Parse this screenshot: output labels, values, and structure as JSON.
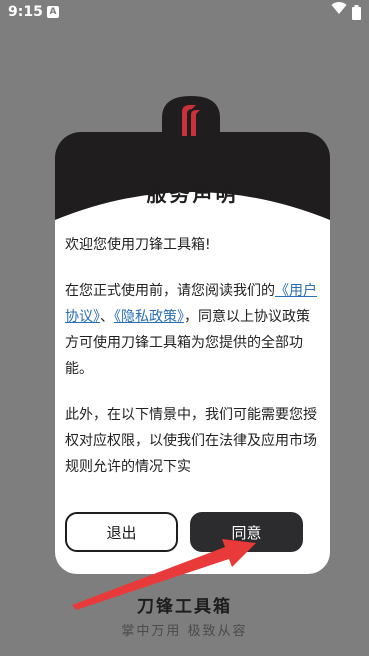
{
  "status_bar": {
    "time": "9:15",
    "notification_letter": "A",
    "icons": [
      "wifi-icon",
      "battery-icon"
    ]
  },
  "dialog": {
    "title": "服务声明",
    "welcome": "欢迎您使用刀锋工具箱!",
    "para1_prefix": "在您正式使用前，请您阅读我们的",
    "link_user_agreement": "《用户协议》",
    "separator": "、",
    "link_privacy_policy": "《隐私政策》",
    "para1_suffix": "，同意以上协议政策方可使用刀锋工具箱为您提供的全部功能。",
    "para2": " 此外，在以下情景中，我们可能需要您授权对应权限，以使我们在法律及应用市场规则允许的情况下实",
    "exit_label": "退出",
    "agree_label": "同意"
  },
  "brand": {
    "name": "刀锋工具箱",
    "slogan": "掌中万用  极致从容"
  },
  "colors": {
    "overlay": "#7e7e7e",
    "header": "#1f1d1d",
    "logo_red": "#c9323a",
    "link": "#2a6fb6",
    "arrow": "#e83a3a"
  }
}
